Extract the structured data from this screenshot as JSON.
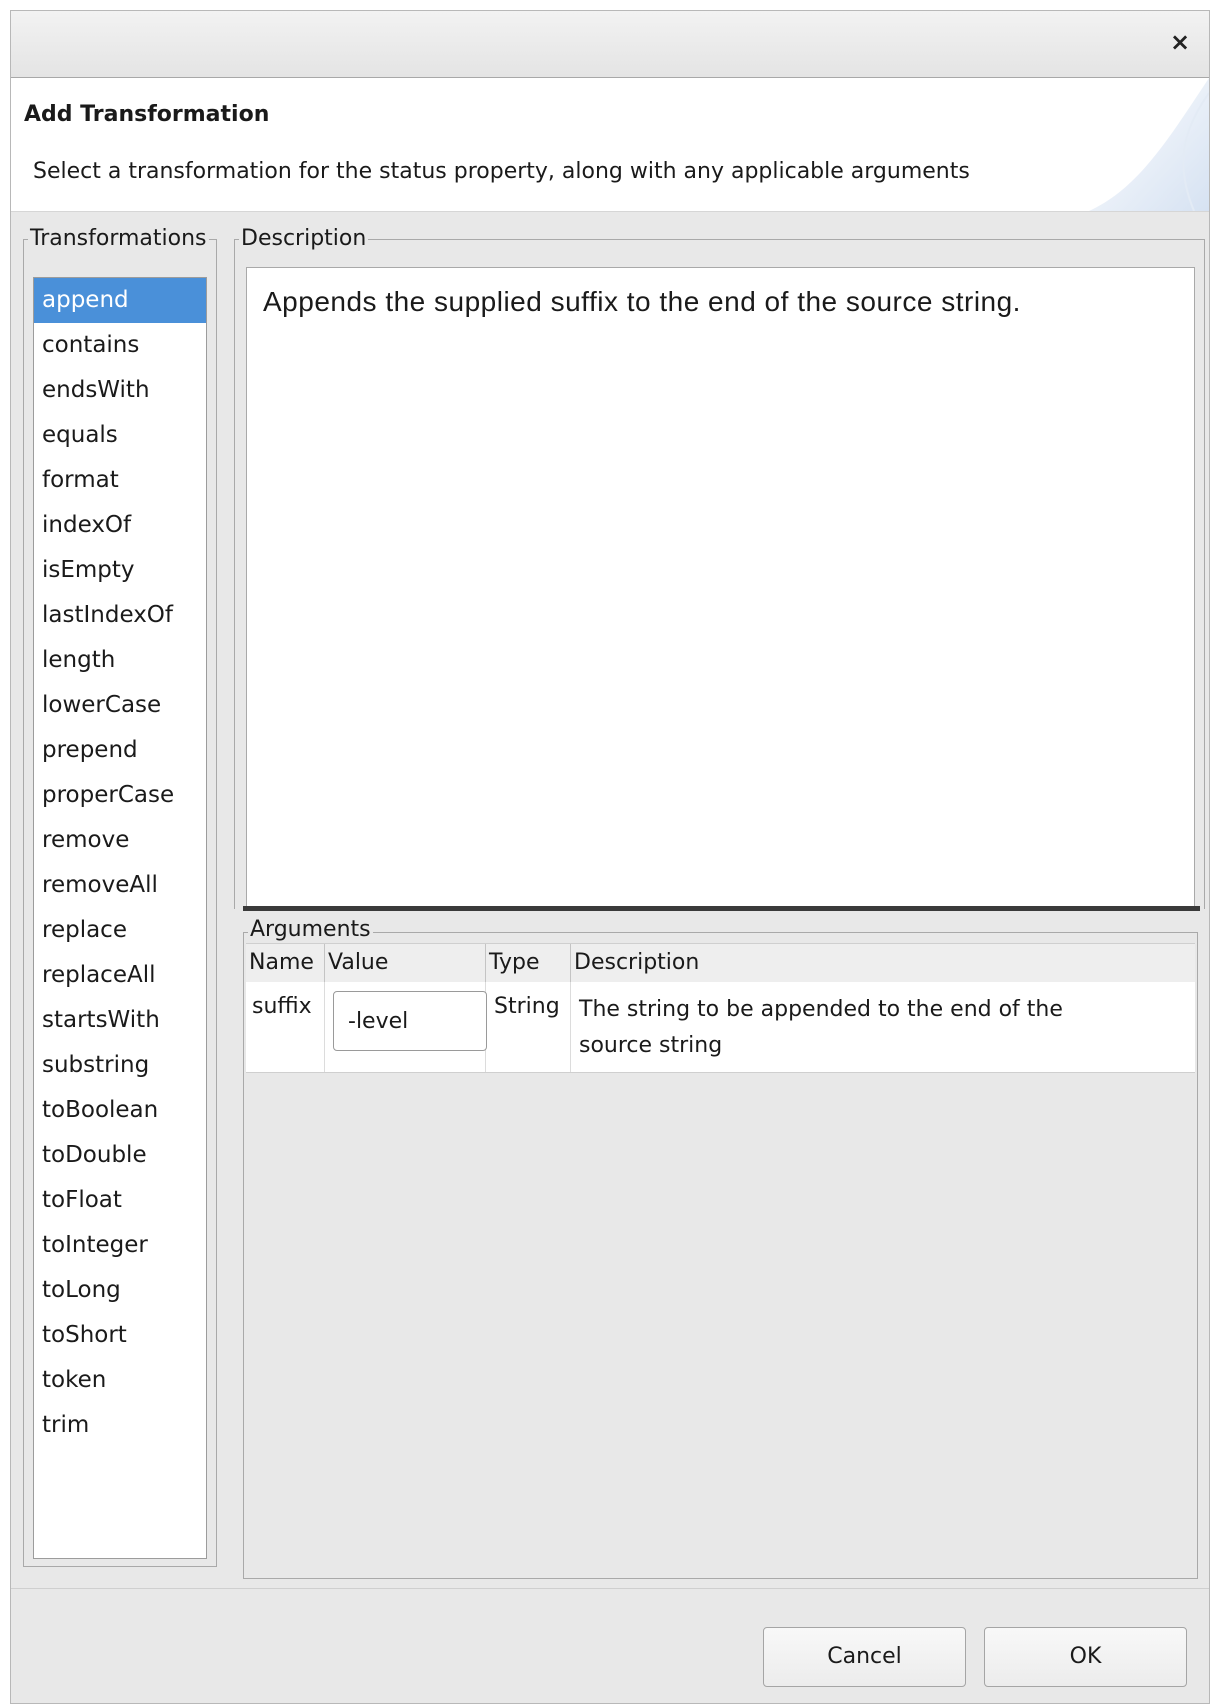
{
  "window": {
    "close_label": "×"
  },
  "banner": {
    "title": "Add Transformation",
    "message": "Select a transformation for the status property, along with any applicable arguments"
  },
  "transformations": {
    "label": "Transformations",
    "selected": "append",
    "items": [
      "append",
      "contains",
      "endsWith",
      "equals",
      "format",
      "indexOf",
      "isEmpty",
      "lastIndexOf",
      "length",
      "lowerCase",
      "prepend",
      "properCase",
      "remove",
      "removeAll",
      "replace",
      "replaceAll",
      "startsWith",
      "substring",
      "toBoolean",
      "toDouble",
      "toFloat",
      "toInteger",
      "toLong",
      "toShort",
      "token",
      "trim"
    ]
  },
  "description": {
    "label": "Description",
    "text": "Appends the supplied suffix to the end of the source string."
  },
  "arguments": {
    "label": "Arguments",
    "columns": {
      "name": "Name",
      "value": "Value",
      "type": "Type",
      "description": "Description"
    },
    "rows": [
      {
        "name": "suffix",
        "value": "-level",
        "type": "String",
        "description_line1": "The string to be appended to the end of the",
        "description_line2": "source string"
      }
    ]
  },
  "buttons": {
    "cancel": "Cancel",
    "ok": "OK"
  },
  "colors": {
    "selection": "#4a90d9",
    "dialog_bg": "#e8e8e8"
  }
}
